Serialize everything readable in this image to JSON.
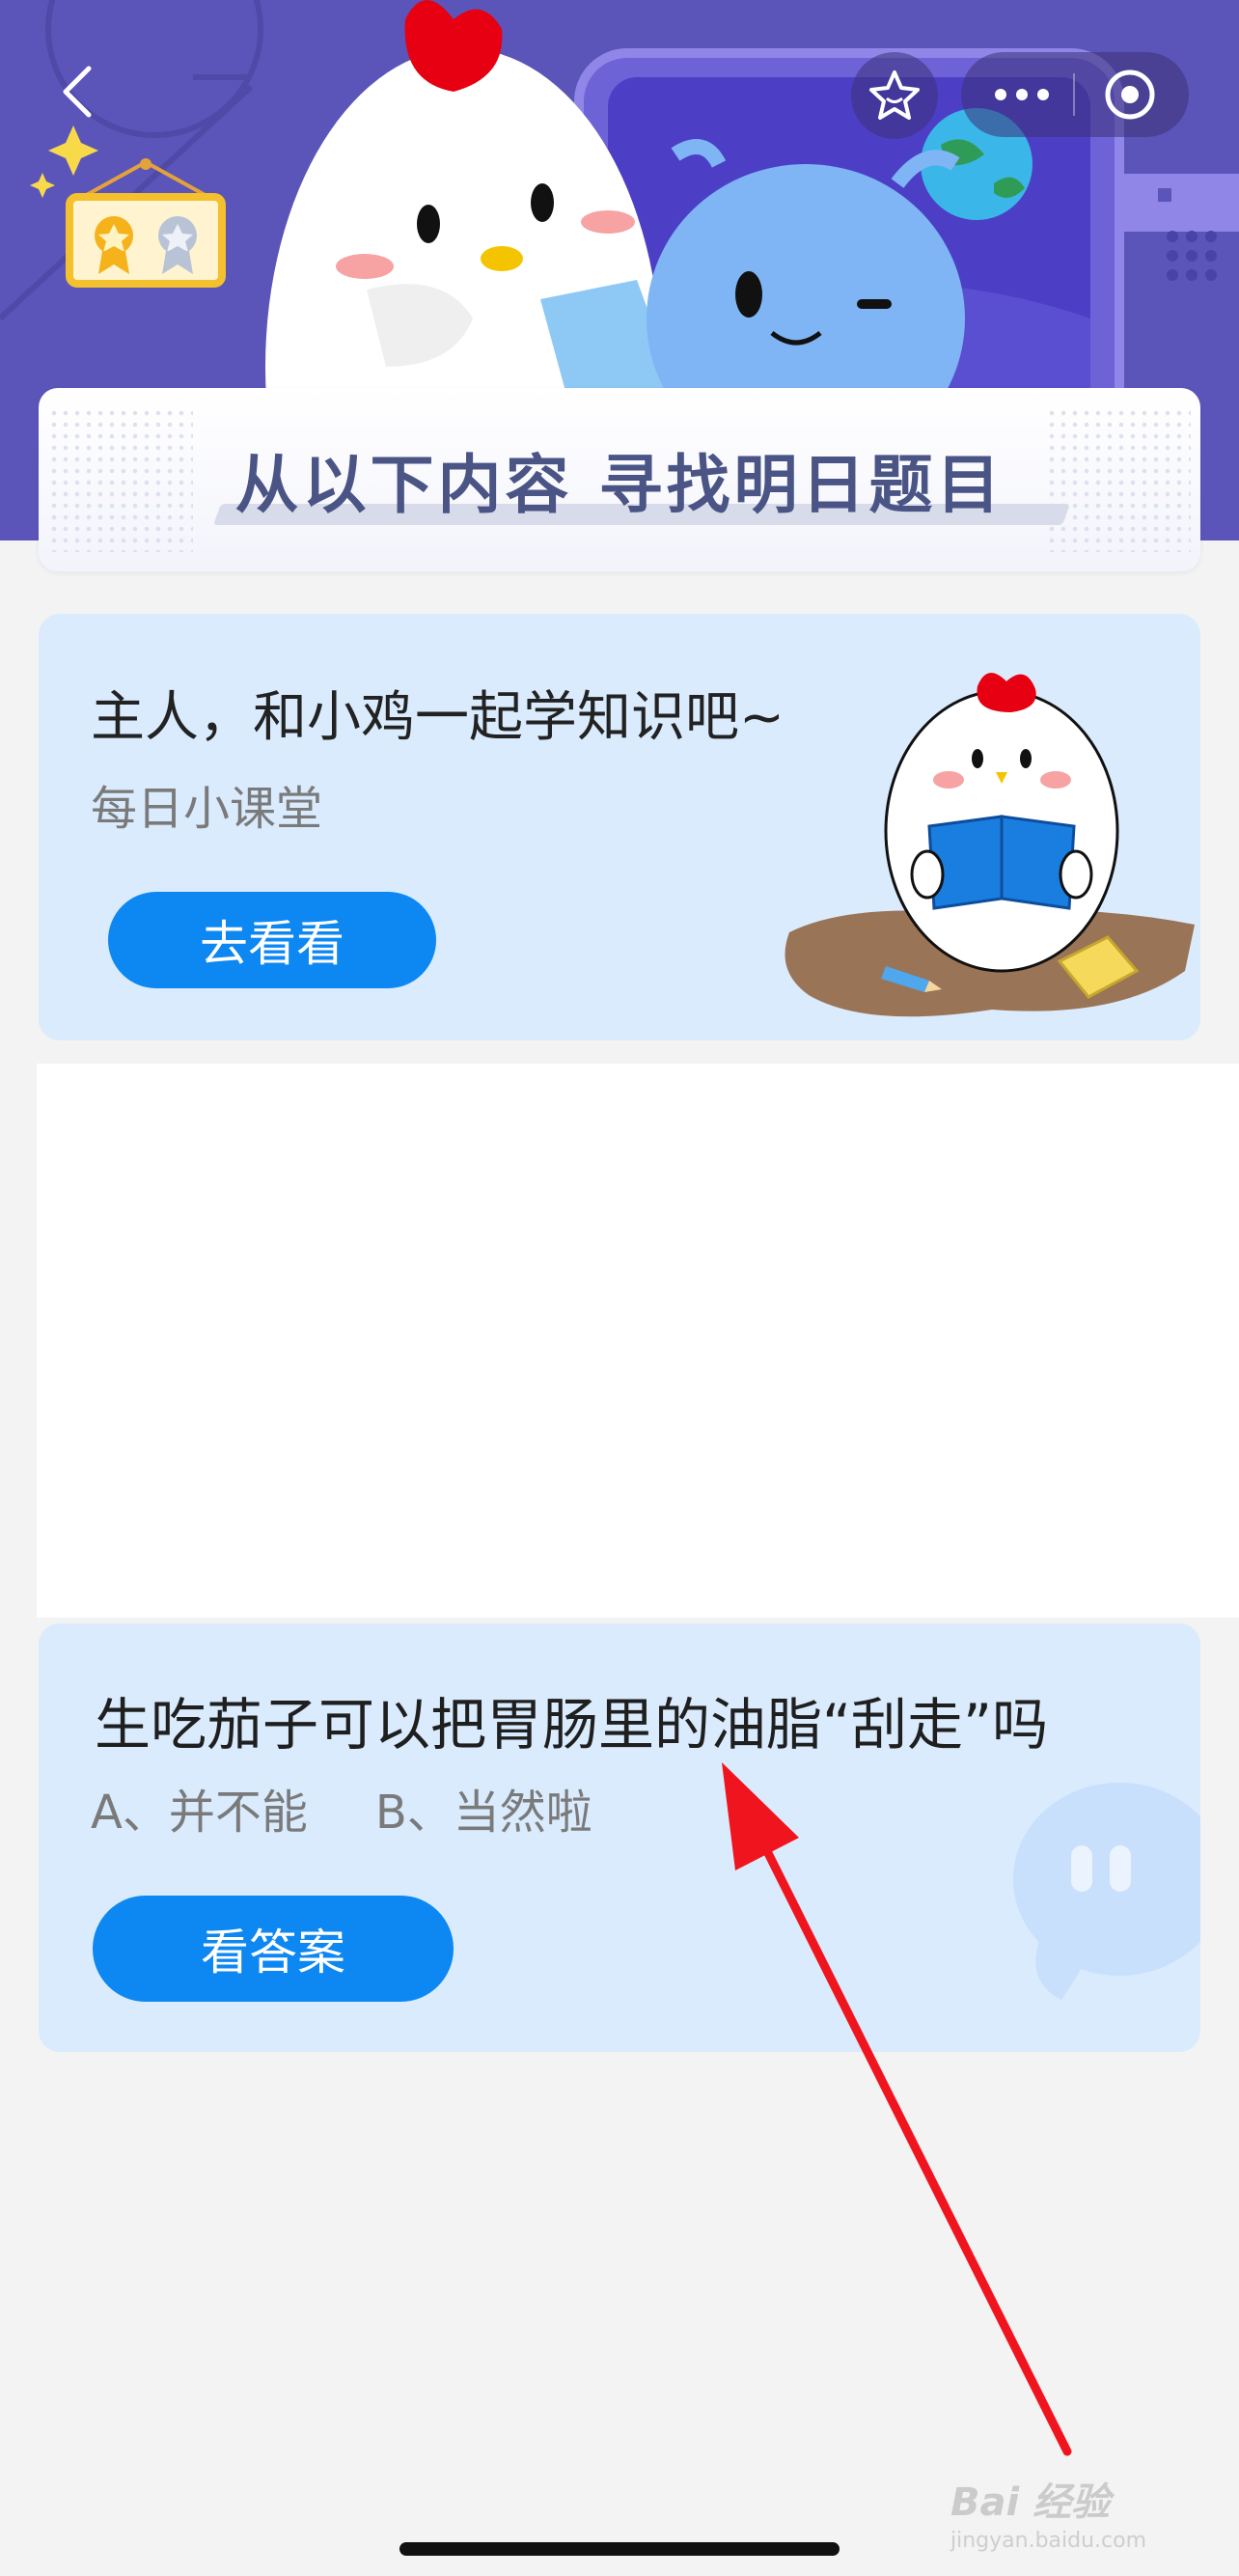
{
  "header": {
    "banner_title": "从以下内容 寻找明日题目"
  },
  "lesson_card": {
    "title": "主人，和小鸡一起学知识吧~",
    "subtitle": "每日小课堂",
    "button_label": "去看看"
  },
  "quiz_card": {
    "question": "生吃茄子可以把胃肠里的油脂“刮走”吗",
    "option_a": "A、并不能",
    "option_b": "B、当然啦",
    "button_label": "看答案"
  },
  "watermark": {
    "brand": "Bai 经验",
    "url": "jingyan.baidu.com"
  },
  "colors": {
    "header_bg": "#5b55b9",
    "card_bg": "#d9ebfd",
    "button_blue": "#0d87f2",
    "arrow_red": "#f0141e"
  },
  "icons": [
    "back-icon",
    "favorite-star-icon",
    "more-icon",
    "close-circle-icon",
    "medal-icon"
  ]
}
